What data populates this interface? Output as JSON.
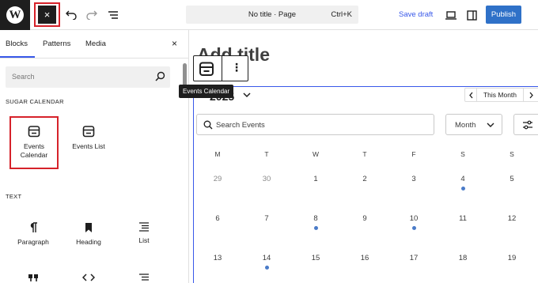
{
  "toolbar": {
    "close_label": "×",
    "doc_title": "No title · Page",
    "shortcut": "Ctrl+K",
    "save_draft": "Save draft",
    "publish": "Publish"
  },
  "inserter": {
    "tabs": [
      "Blocks",
      "Patterns",
      "Media"
    ],
    "active_tab": "Blocks",
    "close_label": "×",
    "search_placeholder": "Search",
    "sections": [
      {
        "label": "SUGAR CALENDAR",
        "blocks": [
          {
            "label": "Events Calendar",
            "icon": "calendar-icon",
            "highlighted": true
          },
          {
            "label": "Events List",
            "icon": "calendar-icon"
          }
        ]
      },
      {
        "label": "TEXT",
        "blocks": [
          {
            "label": "Paragraph",
            "icon": "paragraph-icon"
          },
          {
            "label": "Heading",
            "icon": "bookmark-icon"
          },
          {
            "label": "List",
            "icon": "list-icon"
          },
          {
            "label": "",
            "icon": "quote-icon"
          },
          {
            "label": "",
            "icon": "code-icon"
          },
          {
            "label": "",
            "icon": "list-icon"
          }
        ]
      }
    ]
  },
  "editor": {
    "title_placeholder": "Add title",
    "tooltip": "Events Calendar",
    "calendar": {
      "header_fragment": "2025",
      "nav_label": "This Month",
      "search_placeholder": "Search Events",
      "view": "Month",
      "weekdays": [
        "M",
        "T",
        "W",
        "T",
        "F",
        "S",
        "S"
      ],
      "weeks": [
        [
          {
            "d": "29",
            "muted": true
          },
          {
            "d": "30",
            "muted": true
          },
          {
            "d": "1"
          },
          {
            "d": "2"
          },
          {
            "d": "3"
          },
          {
            "d": "4",
            "event": true
          },
          {
            "d": "5"
          }
        ],
        [
          {
            "d": "6"
          },
          {
            "d": "7"
          },
          {
            "d": "8",
            "event": true
          },
          {
            "d": "9"
          },
          {
            "d": "10",
            "event": true
          },
          {
            "d": "11"
          },
          {
            "d": "12"
          }
        ],
        [
          {
            "d": "13"
          },
          {
            "d": "14",
            "event": true
          },
          {
            "d": "15"
          },
          {
            "d": "16"
          },
          {
            "d": "17"
          },
          {
            "d": "18"
          },
          {
            "d": "19"
          }
        ]
      ]
    }
  },
  "colors": {
    "accent": "#3858e9",
    "publish": "#2f71c8",
    "highlight": "#d6222a",
    "event_dot": "#4a7bc8"
  }
}
